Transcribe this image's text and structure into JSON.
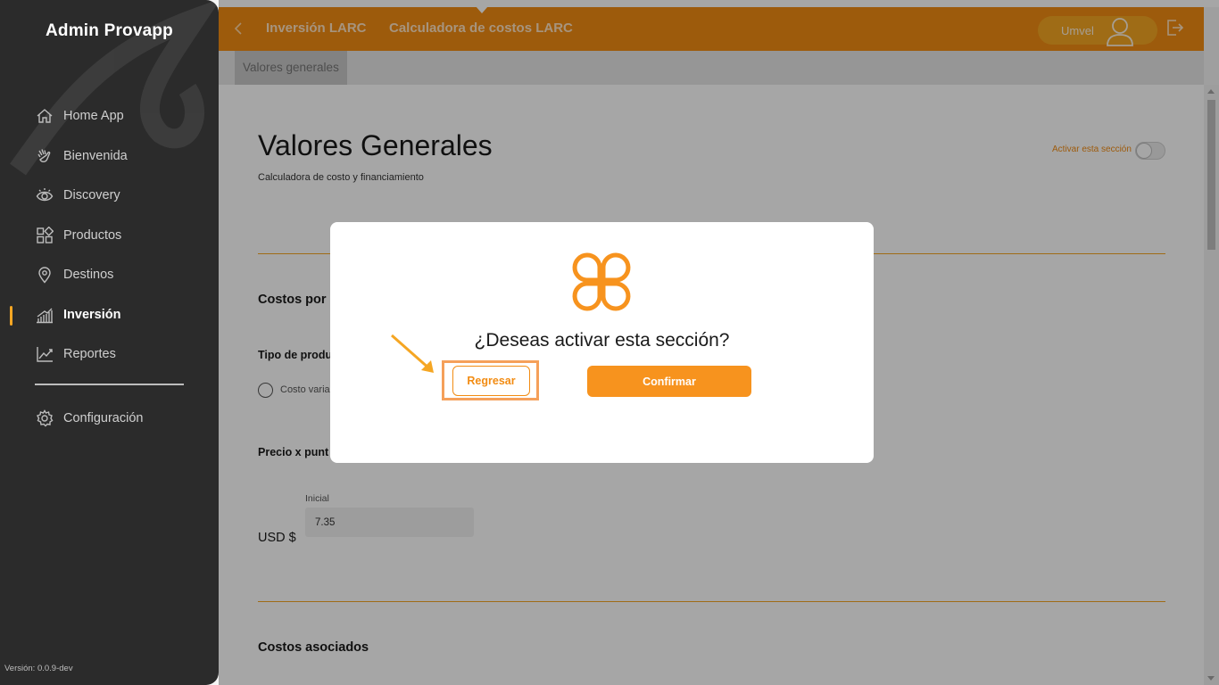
{
  "sidebar": {
    "brand": "Admin Provapp",
    "items": [
      {
        "label": "Home App",
        "icon": "home-icon"
      },
      {
        "label": "Bienvenida",
        "icon": "wave-hand-icon"
      },
      {
        "label": "Discovery",
        "icon": "eye-icon"
      },
      {
        "label": "Productos",
        "icon": "grid-icon"
      },
      {
        "label": "Destinos",
        "icon": "location-pin-icon"
      },
      {
        "label": "Inversión",
        "icon": "bar-chart-icon",
        "active": true
      },
      {
        "label": "Reportes",
        "icon": "line-chart-icon"
      }
    ],
    "config": {
      "label": "Configuración",
      "icon": "gear-icon"
    },
    "version": "Versión: 0.0.9-dev"
  },
  "topbar": {
    "crumb_1": "Inversión LARC",
    "crumb_2": "Calculadora de costos LARC",
    "user_name": "Umvel",
    "accent": "#f28c13"
  },
  "subtabs": {
    "active": "Valores generales"
  },
  "main": {
    "title": "Valores Generales",
    "subtitle": "Calculadora de costo y financiamiento",
    "toggle_label": "Activar esta sección",
    "section_costos_por": "Costos por",
    "tipo_producto_label": "Tipo de produ",
    "radio_label": "Costo varia",
    "precio_label": "Precio x punt",
    "inicial_label": "Inicial",
    "inicial_value": "7.35",
    "currency": "USD $",
    "section_costos_asociados": "Costos asociados"
  },
  "modal": {
    "question": "¿Deseas activar esta sección?",
    "back_label": "Regresar",
    "confirm_label": "Confirmar",
    "logo_color": "#f7931e"
  }
}
